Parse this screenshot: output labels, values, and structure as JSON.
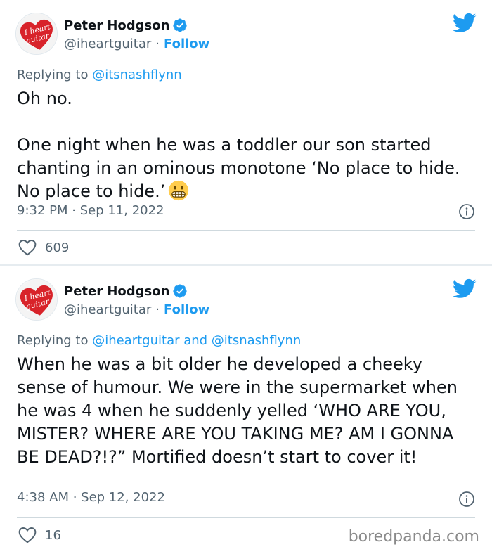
{
  "tweets": [
    {
      "author_name": "Peter Hodgson",
      "handle": "@iheartguitar",
      "separator": "·",
      "follow_label": "Follow",
      "avatar_text": [
        "I heart",
        "guitar"
      ],
      "replying_prefix": "Replying to ",
      "replying_mentions": "@itsnashflynn",
      "text": "Oh no.\n\nOne night when he was a toddler our son started chanting in an ominous monotone ‘No place to hide. No place to hide.’",
      "emoji": "grimacing-face",
      "timestamp": "9:32 PM · Sep 11, 2022",
      "likes": "609"
    },
    {
      "author_name": "Peter Hodgson",
      "handle": "@iheartguitar",
      "separator": "·",
      "follow_label": "Follow",
      "avatar_text": [
        "I heart",
        "guitar"
      ],
      "replying_prefix": "Replying to ",
      "replying_mentions": "@iheartguitar and @itsnashflynn",
      "text": "When he was a bit older he developed a cheeky sense of humour. We were in the supermarket when he was 4 when he suddenly yelled ‘WHO ARE YOU, MISTER? WHERE ARE YOU TAKING ME? AM I GONNA BE DEAD?!?” Mortified doesn’t start to cover it!",
      "timestamp": "4:38 AM · Sep 12, 2022",
      "likes": "16"
    }
  ],
  "watermark": "boredpanda.com",
  "colors": {
    "twitter_blue": "#1d9bf0",
    "secondary_text": "#536471",
    "avatar_red": "#d8232a"
  },
  "icons": [
    "verified-badge-icon",
    "twitter-bird-icon",
    "info-icon",
    "heart-icon",
    "grimacing-emoji-icon"
  ]
}
